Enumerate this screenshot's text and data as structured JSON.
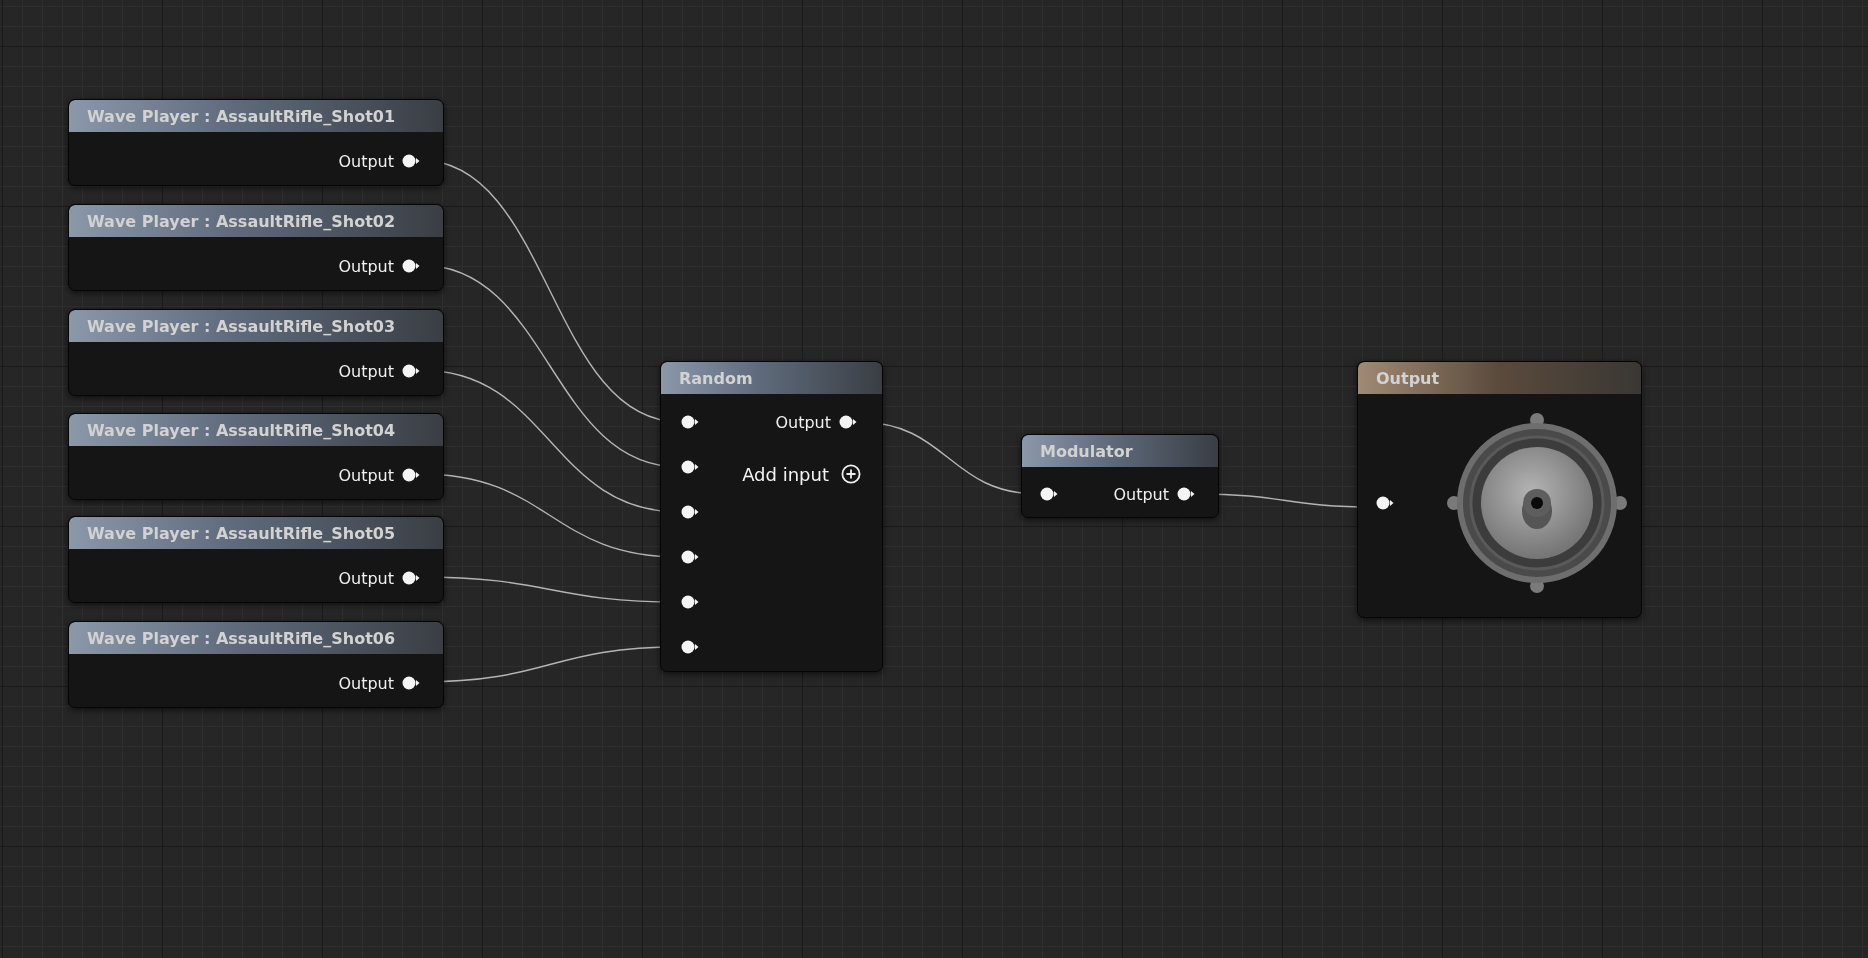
{
  "wave_players": [
    {
      "title": "Wave Player : AssaultRifle_Shot01",
      "output_label": "Output"
    },
    {
      "title": "Wave Player : AssaultRifle_Shot02",
      "output_label": "Output"
    },
    {
      "title": "Wave Player : AssaultRifle_Shot03",
      "output_label": "Output"
    },
    {
      "title": "Wave Player : AssaultRifle_Shot04",
      "output_label": "Output"
    },
    {
      "title": "Wave Player : AssaultRifle_Shot05",
      "output_label": "Output"
    },
    {
      "title": "Wave Player : AssaultRifle_Shot06",
      "output_label": "Output"
    }
  ],
  "random": {
    "title": "Random",
    "output_label": "Output",
    "add_input_label": "Add input"
  },
  "modulator": {
    "title": "Modulator",
    "output_label": "Output"
  },
  "output": {
    "title": "Output"
  }
}
